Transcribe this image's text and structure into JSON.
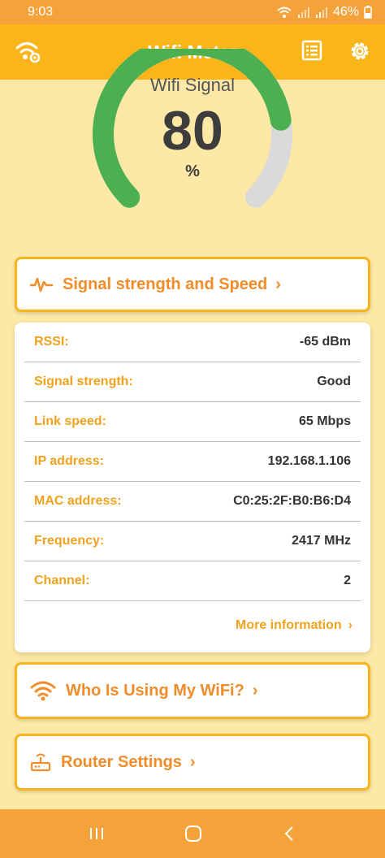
{
  "status": {
    "time": "9:03",
    "battery": "46%"
  },
  "app": {
    "title": "Wifi Meter"
  },
  "gauge": {
    "label": "Wifi Signal",
    "value": "80",
    "unit": "%",
    "fraction": 0.8
  },
  "buttons": {
    "signal": "Signal strength and Speed",
    "who": "Who Is Using My WiFi?",
    "router": "Router Settings"
  },
  "info": {
    "rows": [
      {
        "key": "RSSI:",
        "value": "-65 dBm"
      },
      {
        "key": "Signal strength:",
        "value": "Good"
      },
      {
        "key": "Link speed:",
        "value": "65 Mbps"
      },
      {
        "key": "IP address:",
        "value": "192.168.1.106"
      },
      {
        "key": "MAC address:",
        "value": "C0:25:2F:B0:B6:D4"
      },
      {
        "key": "Frequency:",
        "value": "2417 MHz"
      },
      {
        "key": "Channel:",
        "value": "2"
      }
    ],
    "more": "More information"
  },
  "colors": {
    "accent": "#F9B51A",
    "text_accent": "#F08C2A",
    "gauge_green": "#4CAF50",
    "gauge_track": "#DADADA"
  },
  "icons": [
    "wifi-settings-icon",
    "list-icon",
    "gear-icon",
    "pulse-icon",
    "wifi-icon",
    "router-icon",
    "chevron-right-icon",
    "recents-icon",
    "home-icon",
    "back-icon"
  ]
}
